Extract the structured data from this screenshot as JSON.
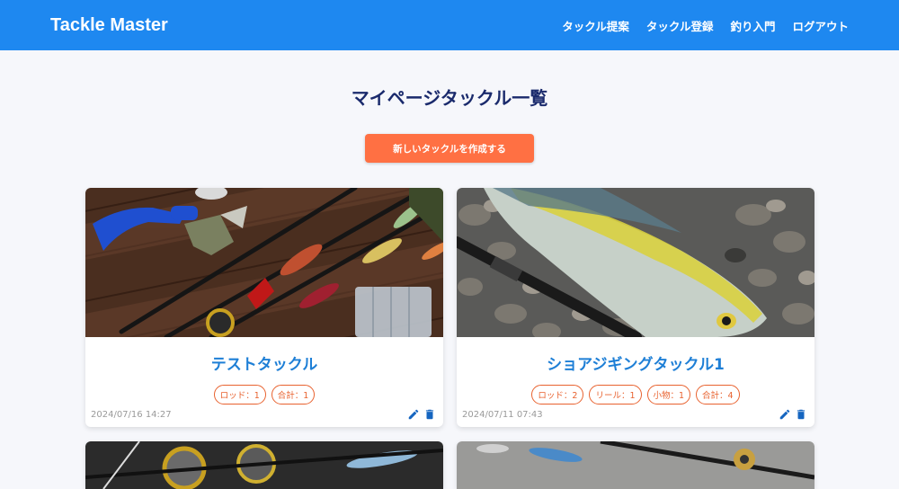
{
  "app": {
    "brand": "Tackle Master"
  },
  "nav": {
    "items": [
      {
        "label": "タックル提案"
      },
      {
        "label": "タックル登録"
      },
      {
        "label": "釣り入門"
      },
      {
        "label": "ログアウト"
      }
    ]
  },
  "page": {
    "title": "マイページタックル一覧",
    "create_button": "新しいタックルを作成する"
  },
  "cards": [
    {
      "title": "テストタックル",
      "tags": [
        "ロッド：1",
        "合計：1"
      ],
      "date": "2024/07/16 14:27",
      "icons": [
        "edit-icon",
        "trash-icon"
      ]
    },
    {
      "title": "ショアジギングタックル1",
      "tags": [
        "ロッド：2",
        "リール：1",
        "小物：1",
        "合計：4"
      ],
      "date": "2024/07/11 07:43",
      "icons": [
        "edit-icon",
        "trash-icon"
      ]
    }
  ],
  "colors": {
    "navbar": "#1e88f0",
    "accent": "#ff7043",
    "title": "#1a2a6c",
    "card_title": "#1e7fd6",
    "icon": "#1565c0"
  }
}
